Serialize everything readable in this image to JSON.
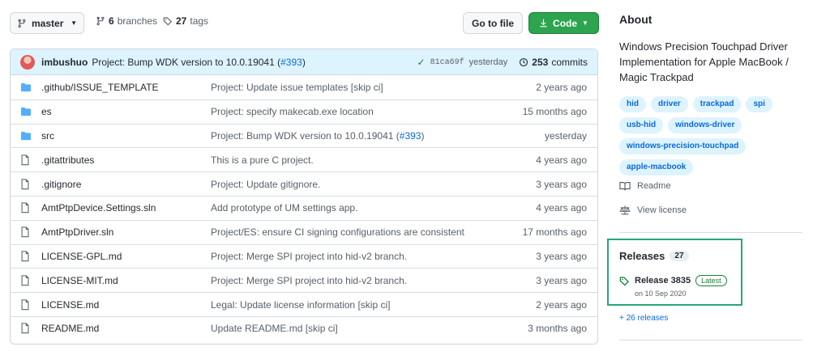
{
  "toolbar": {
    "branch": "master",
    "branches_count": "6",
    "branches_label": "branches",
    "tags_count": "27",
    "tags_label": "tags",
    "go_to_file": "Go to file",
    "code": "Code"
  },
  "commit": {
    "author": "imbushuo",
    "message": "Project: Bump WDK version to 10.0.19041 (",
    "pr": "#393",
    "message_end": ")",
    "sha": "81ca69f",
    "when": "yesterday",
    "commits_count": "253",
    "commits_label": "commits"
  },
  "files": [
    {
      "type": "dir",
      "name": ".github/ISSUE_TEMPLATE",
      "msg": "Project: Update issue templates [skip ci]",
      "pr": "",
      "msg_end": "",
      "age": "2 years ago"
    },
    {
      "type": "dir",
      "name": "es",
      "msg": "Project: specify makecab.exe location",
      "pr": "",
      "msg_end": "",
      "age": "15 months ago"
    },
    {
      "type": "dir",
      "name": "src",
      "msg": "Project: Bump WDK version to 10.0.19041 (",
      "pr": "#393",
      "msg_end": ")",
      "age": "yesterday"
    },
    {
      "type": "file",
      "name": ".gitattributes",
      "msg": "This is a pure C project.",
      "pr": "",
      "msg_end": "",
      "age": "4 years ago"
    },
    {
      "type": "file",
      "name": ".gitignore",
      "msg": "Project: Update gitignore.",
      "pr": "",
      "msg_end": "",
      "age": "3 years ago"
    },
    {
      "type": "file",
      "name": "AmtPtpDevice.Settings.sln",
      "msg": "Add prototype of UM settings app.",
      "pr": "",
      "msg_end": "",
      "age": "4 years ago"
    },
    {
      "type": "file",
      "name": "AmtPtpDriver.sln",
      "msg": "Project/ES: ensure CI signing configurations are consistent",
      "pr": "",
      "msg_end": "",
      "age": "17 months ago"
    },
    {
      "type": "file",
      "name": "LICENSE-GPL.md",
      "msg": "Project: Merge SPI project into hid-v2 branch.",
      "pr": "",
      "msg_end": "",
      "age": "3 years ago"
    },
    {
      "type": "file",
      "name": "LICENSE-MIT.md",
      "msg": "Project: Merge SPI project into hid-v2 branch.",
      "pr": "",
      "msg_end": "",
      "age": "3 years ago"
    },
    {
      "type": "file",
      "name": "LICENSE.md",
      "msg": "Legal: Update license information [skip ci]",
      "pr": "",
      "msg_end": "",
      "age": "2 years ago"
    },
    {
      "type": "file",
      "name": "README.md",
      "msg": "Update README.md [skip ci]",
      "pr": "",
      "msg_end": "",
      "age": "3 months ago"
    }
  ],
  "about": {
    "title": "About",
    "description": "Windows Precision Touchpad Driver Implementation for Apple MacBook / Magic Trackpad",
    "topics": [
      "hid",
      "driver",
      "trackpad",
      "spi",
      "usb-hid",
      "windows-driver",
      "windows-precision-touchpad",
      "apple-macbook"
    ],
    "readme": "Readme",
    "license": "View license"
  },
  "releases": {
    "title": "Releases",
    "count": "27",
    "latest_name": "Release 3835",
    "latest_badge": "Latest",
    "latest_date": "on 10 Sep 2020",
    "more": "+ 26 releases"
  },
  "colors": {
    "accent": "#0969da",
    "code_button": "#2da44e",
    "folder": "#54aeff",
    "highlight_box": "#2aa57a"
  }
}
